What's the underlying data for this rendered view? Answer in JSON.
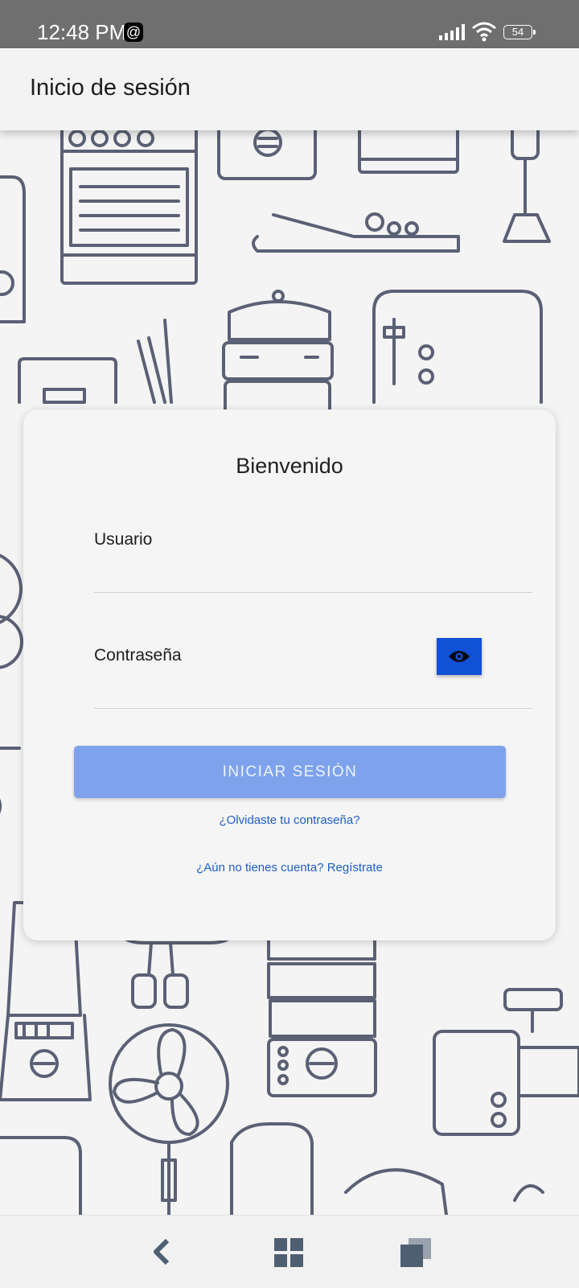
{
  "status_bar": {
    "time": "12:48 PM",
    "battery": "54",
    "icons": [
      "threads-icon",
      "signal-icon",
      "wifi-icon",
      "battery-icon"
    ]
  },
  "app_bar": {
    "title": "Inicio de sesión"
  },
  "login_card": {
    "title": "Bienvenido",
    "username_label": "Usuario",
    "password_label": "Contraseña",
    "toggle_visibility_icon": "eye-icon",
    "submit_label": "INICIAR SESIÓN",
    "forgot_link": "¿Olvidaste tu contraseña?",
    "register_link": "¿Aún no tienes cuenta? Regístrate"
  },
  "nav_bar": {
    "icons": [
      "back-icon",
      "home-icon",
      "recents-icon"
    ]
  },
  "colors": {
    "primary": "#1151d6",
    "button_disabled": "#7ea3ec",
    "link": "#1e5ec7",
    "doodle_stroke": "#5a6175"
  }
}
